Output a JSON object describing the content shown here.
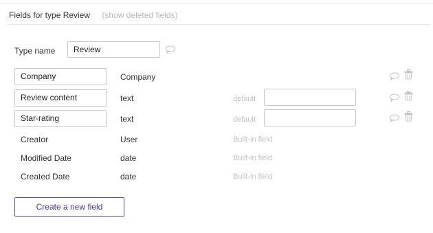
{
  "header": {
    "title": "Fields for type Review",
    "show_deleted": "(show deleted fields)"
  },
  "type_name": {
    "label": "Type name",
    "value": "Review"
  },
  "fields": [
    {
      "name": "Company",
      "type": "Company"
    },
    {
      "name": "Review content",
      "type": "text",
      "default_label": "default",
      "default_value": ""
    },
    {
      "name": "Star-rating",
      "type": "text",
      "default_label": "default",
      "default_value": ""
    }
  ],
  "builtin_fields": [
    {
      "name": "Creator",
      "type": "User",
      "note": "Built-in field"
    },
    {
      "name": "Modified Date",
      "type": "date",
      "note": "Built-in field"
    },
    {
      "name": "Created Date",
      "type": "date",
      "note": "Built-in field"
    }
  ],
  "create_button": "Create a new field",
  "icons": {
    "comment": "comment-icon",
    "trash": "trash-icon"
  },
  "colors": {
    "accent": "#4b2fc0",
    "muted_text": "#c2c2c2",
    "icon": "#c4c4c4"
  }
}
